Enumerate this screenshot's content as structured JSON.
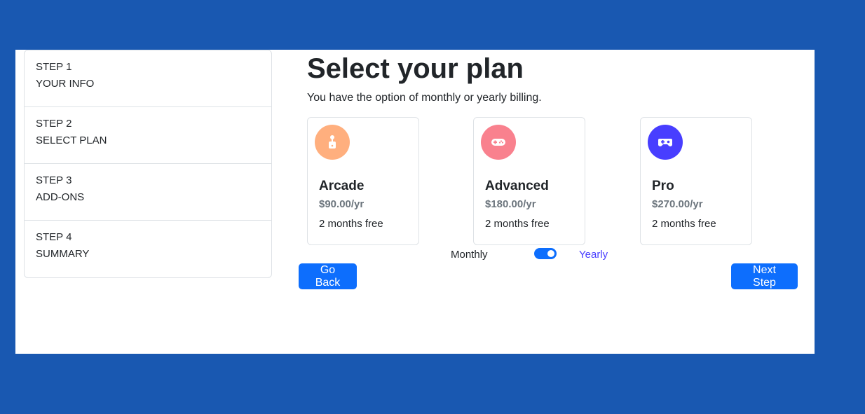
{
  "steps": [
    {
      "number": "STEP 1",
      "label": "YOUR INFO"
    },
    {
      "number": "STEP 2",
      "label": "SELECT PLAN"
    },
    {
      "number": "STEP 3",
      "label": "ADD-ONS"
    },
    {
      "number": "STEP 4",
      "label": "SUMMARY"
    }
  ],
  "main": {
    "title": "Select your plan",
    "subtitle": "You have the option of monthly or yearly billing."
  },
  "plans": [
    {
      "name": "Arcade",
      "price": "$90.00/yr",
      "promo": "2 months free",
      "icon": "joystick-icon",
      "color": "#ffaf7e"
    },
    {
      "name": "Advanced",
      "price": "$180.00/yr",
      "promo": "2 months free",
      "icon": "gamepad-icon",
      "color": "#f9818e"
    },
    {
      "name": "Pro",
      "price": "$270.00/yr",
      "promo": "2 months free",
      "icon": "controller-icon",
      "color": "#483eff"
    }
  ],
  "billing": {
    "monthly_label": "Monthly",
    "yearly_label": "Yearly",
    "selected": "Yearly"
  },
  "buttons": {
    "back_label": "Go Back",
    "next_label": "Next Step"
  },
  "colors": {
    "background": "#1958b1",
    "accent": "#0d6efd",
    "yearly_active": "#483eff"
  }
}
